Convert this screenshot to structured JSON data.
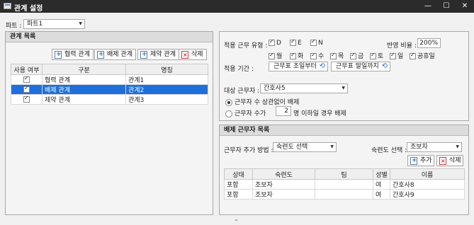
{
  "window": {
    "title": "관계 설정",
    "minimize": "—",
    "maximize": "☐",
    "close": "✕"
  },
  "part": {
    "label": "파트 :",
    "value": "파트1"
  },
  "relation_list": {
    "title": "관계 목록",
    "buttons": {
      "cooperate": "협력 관계",
      "exclude": "배제 관계",
      "restrict": "제약 관계",
      "delete": "삭제"
    },
    "columns": [
      "사용 여부",
      "구분",
      "명칭"
    ],
    "rows": [
      {
        "used": true,
        "type": "협력 관계",
        "name": "관계1",
        "selected": false
      },
      {
        "used": true,
        "type": "배제 관계",
        "name": "관계2",
        "selected": true
      },
      {
        "used": true,
        "type": "제약 관계",
        "name": "관계3",
        "selected": false
      }
    ]
  },
  "settings": {
    "shift_type_label": "적용 근무 유형 :",
    "shift_types": [
      "D",
      "E",
      "N"
    ],
    "apply_ratio_label": "반영 비율 :",
    "apply_ratio_value": "200%",
    "weekdays": [
      "월",
      "화",
      "수",
      "목",
      "금",
      "토",
      "일",
      "공휴일"
    ],
    "period_label": "적용 기간 :",
    "period_start": "근무표 초일부터",
    "period_end": "근무표 말일까지",
    "target_label": "대상 근무자 :",
    "target_value": "간호사5",
    "option_unrelated": "근무자 수 상관없이 배제",
    "option_count_prefix": "근무자 수가",
    "option_count_value": "2",
    "option_count_suffix": "명 이하일 경우 배제"
  },
  "excluded": {
    "title": "배제 근무자 목록",
    "add_method_label": "근무자 추가 방법 :",
    "add_method_value": "숙련도 선택",
    "skill_label": "숙련도 선택 :",
    "skill_value": "조보자",
    "add_button": "추가",
    "delete_button": "삭제",
    "columns": [
      "상태",
      "숙련도",
      "팀",
      "성별",
      "이름"
    ],
    "rows": [
      {
        "status": "포함",
        "skill": "조보자",
        "team": "",
        "gender": "여",
        "name": "간호사8"
      },
      {
        "status": "포함",
        "skill": "조보자",
        "team": "",
        "gender": "여",
        "name": "간호사9"
      }
    ]
  },
  "footer": {
    "grip": "⌃"
  }
}
